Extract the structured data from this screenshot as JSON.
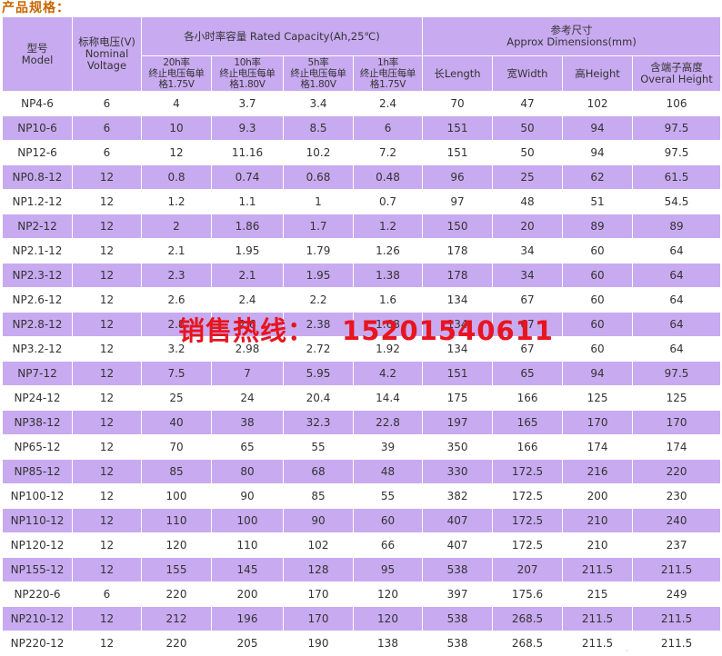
{
  "title": "产品规格：",
  "header": {
    "model_cn": "型号",
    "model_en": "Model",
    "voltage_cn": "标称电压(V)",
    "voltage_en1": "Nominal",
    "voltage_en2": "Voltage",
    "capacity_group": "各小时率容量 Rated Capacity(Ah,25℃)",
    "dimensions_cn": "参考尺寸",
    "dimensions_en": "Approx Dimensions(mm)",
    "rates": [
      {
        "rate": "20h率",
        "cond1": "终止电压每单",
        "cond2": "格1.75V"
      },
      {
        "rate": "10h率",
        "cond1": "终止电压每单",
        "cond2": "格1.80V"
      },
      {
        "rate": "5h率",
        "cond1": "终止电压每单",
        "cond2": "格1.80V"
      },
      {
        "rate": "1h率",
        "cond1": "终止电压每单",
        "cond2": "格1.75V"
      }
    ],
    "length": "长Length",
    "width": "宽Width",
    "height": "高Height",
    "overall_cn": "含端子高度",
    "overall_en": "Overal Height"
  },
  "rows": [
    [
      "NP4-6",
      "6",
      "4",
      "3.7",
      "3.4",
      "2.4",
      "70",
      "47",
      "102",
      "106"
    ],
    [
      "NP10-6",
      "6",
      "10",
      "9.3",
      "8.5",
      "6",
      "151",
      "50",
      "94",
      "97.5"
    ],
    [
      "NP12-6",
      "6",
      "12",
      "11.16",
      "10.2",
      "7.2",
      "151",
      "50",
      "94",
      "97.5"
    ],
    [
      "NP0.8-12",
      "12",
      "0.8",
      "0.74",
      "0.68",
      "0.48",
      "96",
      "25",
      "62",
      "61.5"
    ],
    [
      "NP1.2-12",
      "12",
      "1.2",
      "1.1",
      "1",
      "0.7",
      "97",
      "48",
      "51",
      "54.5"
    ],
    [
      "NP2-12",
      "12",
      "2",
      "1.86",
      "1.7",
      "1.2",
      "150",
      "20",
      "89",
      "89"
    ],
    [
      "NP2.1-12",
      "12",
      "2.1",
      "1.95",
      "1.79",
      "1.26",
      "178",
      "34",
      "60",
      "64"
    ],
    [
      "NP2.3-12",
      "12",
      "2.3",
      "2.1",
      "1.95",
      "1.38",
      "178",
      "34",
      "60",
      "64"
    ],
    [
      "NP2.6-12",
      "12",
      "2.6",
      "2.4",
      "2.2",
      "1.6",
      "134",
      "67",
      "60",
      "64"
    ],
    [
      "NP2.8-12",
      "12",
      "2.8",
      "2.6",
      "2.38",
      "1.68",
      "134",
      "67",
      "60",
      "64"
    ],
    [
      "NP3.2-12",
      "12",
      "3.2",
      "2.98",
      "2.72",
      "1.92",
      "134",
      "67",
      "60",
      "64"
    ],
    [
      "NP7-12",
      "12",
      "7.5",
      "7",
      "5.95",
      "4.2",
      "151",
      "65",
      "94",
      "97.5"
    ],
    [
      "NP24-12",
      "12",
      "25",
      "24",
      "20.4",
      "14.4",
      "175",
      "166",
      "125",
      "125"
    ],
    [
      "NP38-12",
      "12",
      "40",
      "38",
      "32.3",
      "22.8",
      "197",
      "165",
      "170",
      "170"
    ],
    [
      "NP65-12",
      "12",
      "70",
      "65",
      "55",
      "39",
      "350",
      "166",
      "174",
      "174"
    ],
    [
      "NP85-12",
      "12",
      "85",
      "80",
      "68",
      "48",
      "330",
      "172.5",
      "216",
      "220"
    ],
    [
      "NP100-12",
      "12",
      "100",
      "90",
      "85",
      "55",
      "382",
      "172.5",
      "200",
      "230"
    ],
    [
      "NP110-12",
      "12",
      "110",
      "100",
      "90",
      "60",
      "407",
      "172.5",
      "210",
      "240"
    ],
    [
      "NP120-12",
      "12",
      "120",
      "110",
      "102",
      "66",
      "407",
      "172.5",
      "210",
      "237"
    ],
    [
      "NP155-12",
      "12",
      "155",
      "145",
      "128",
      "95",
      "538",
      "207",
      "211.5",
      "211.5"
    ],
    [
      "NP220-6",
      "6",
      "220",
      "200",
      "170",
      "120",
      "397",
      "175.6",
      "215",
      "249"
    ],
    [
      "NP210-12",
      "12",
      "212",
      "196",
      "170",
      "120",
      "538",
      "268.5",
      "211.5",
      "211.5"
    ],
    [
      "NP220-12",
      "12",
      "220",
      "205",
      "190",
      "138",
      "538",
      "268.5",
      "211.5",
      "211.5"
    ]
  ],
  "watermark": {
    "label": "销售热线：",
    "phone": "15201540611"
  },
  "colors": {
    "header_bg": "#c8aaf0",
    "stripe_bg": "#c8aaf0",
    "title_color": "#c86400",
    "watermark_color": "#e8141e"
  }
}
